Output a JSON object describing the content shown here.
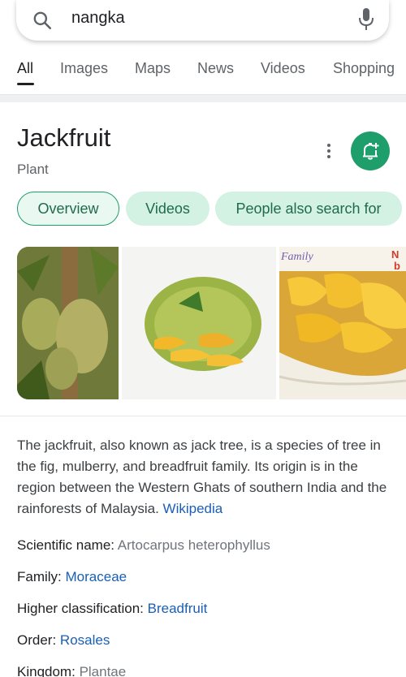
{
  "search": {
    "query": "nangka"
  },
  "tabs": [
    {
      "label": "All",
      "active": true
    },
    {
      "label": "Images"
    },
    {
      "label": "Maps"
    },
    {
      "label": "News"
    },
    {
      "label": "Videos"
    },
    {
      "label": "Shopping"
    }
  ],
  "knowledge_panel": {
    "title": "Jackfruit",
    "subtitle": "Plant",
    "chips": [
      "Overview",
      "Videos",
      "People also search for"
    ],
    "image_overlay_text": {
      "family": "Family",
      "n": "N",
      "b": "b"
    },
    "description": "The jackfruit, also known as jack tree, is a species of tree in the fig, mulberry, and breadfruit family. Its origin is in the region between the Western Ghats of southern India and the rainforests of Malaysia.",
    "description_link": "Wikipedia",
    "facts": [
      {
        "label": "Scientific name:",
        "value": "Artocarpus heterophyllus",
        "style": "gray"
      },
      {
        "label": "Family:",
        "value": "Moraceae",
        "style": "link"
      },
      {
        "label": "Higher classification:",
        "value": "Breadfruit",
        "style": "link"
      },
      {
        "label": "Order:",
        "value": "Rosales",
        "style": "link"
      },
      {
        "label": "Kingdom:",
        "value": "Plantae",
        "style": "gray"
      }
    ]
  },
  "colors": {
    "accent_green": "#1e9e6a",
    "chip_bg": "#d4f2e4",
    "link_blue": "#1a5fb4"
  }
}
